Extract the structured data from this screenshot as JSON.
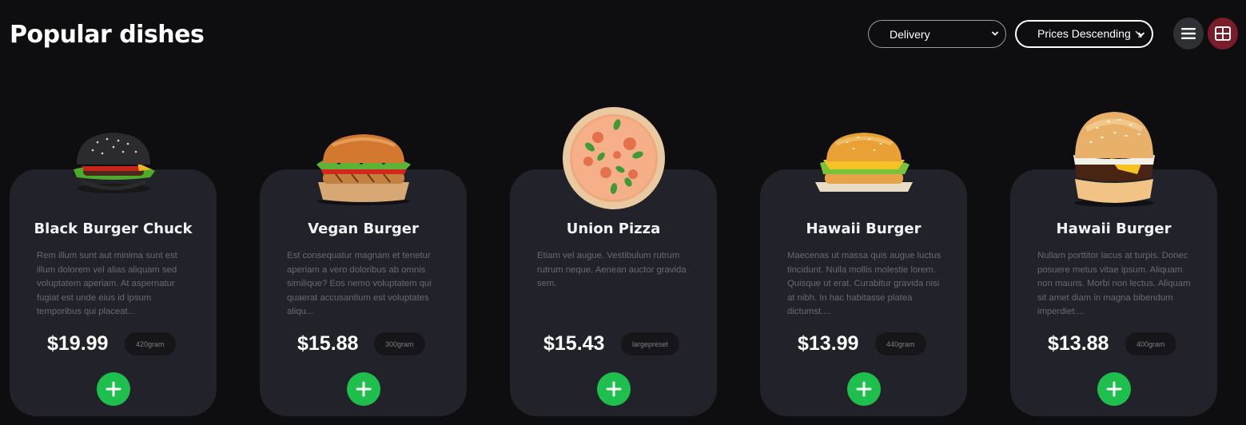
{
  "header": {
    "title": "Popular dishes",
    "delivery_select": "Delivery",
    "sort_select": "Prices Descending ↘"
  },
  "icons": {
    "list_view": "list-icon",
    "grid_view": "grid-icon",
    "add": "plus-icon",
    "dropdown": "chevron-down-icon"
  },
  "colors": {
    "background": "#0e0e10",
    "card": "#22222a",
    "add_button": "#1fbf4d",
    "grid_active": "#7b1c2b"
  },
  "dishes": [
    {
      "name": "Black Burger Chuck",
      "description": "Rem illum sunt aut minima sunt est illum dolorem vel alias aliquam sed voluptatem aperiam. At aspernatur fugiat est unde eius id ipsum temporibus qui placeat...",
      "price": "$19.99",
      "weight": "420gram",
      "image": "black-burger"
    },
    {
      "name": "Vegan Burger",
      "description": "Est consequatur magnam et tenetur aperiam a vero doloribus ab omnis similique? Eos nemo voluptatem qui quaerat accusantium est voluptates aliqu...",
      "price": "$15.88",
      "weight": "300gram",
      "image": "vegan-burger"
    },
    {
      "name": "Union Pizza",
      "description": "Etiam vel augue. Vestibulum rutrum rutrum neque. Aenean auctor gravida sem.",
      "price": "$15.43",
      "weight": "largepreset",
      "image": "pizza"
    },
    {
      "name": "Hawaii Burger",
      "description": "Maecenas ut massa quis augue luctus tincidunt. Nulla mollis molestie lorem. Quisque ut erat. Curabitur gravida nisi at nibh. In hac habitasse platea dictumst....",
      "price": "$13.99",
      "weight": "440gram",
      "image": "cheese-burger"
    },
    {
      "name": "Hawaii Burger",
      "description": "Nullam porttitor lacus at turpis. Donec posuere metus vitae ipsum. Aliquam non mauris. Morbi non lectus. Aliquam sit amet diam in magna bibendum imperdiet....",
      "price": "$13.88",
      "weight": "400gram",
      "image": "classic-burger"
    }
  ]
}
